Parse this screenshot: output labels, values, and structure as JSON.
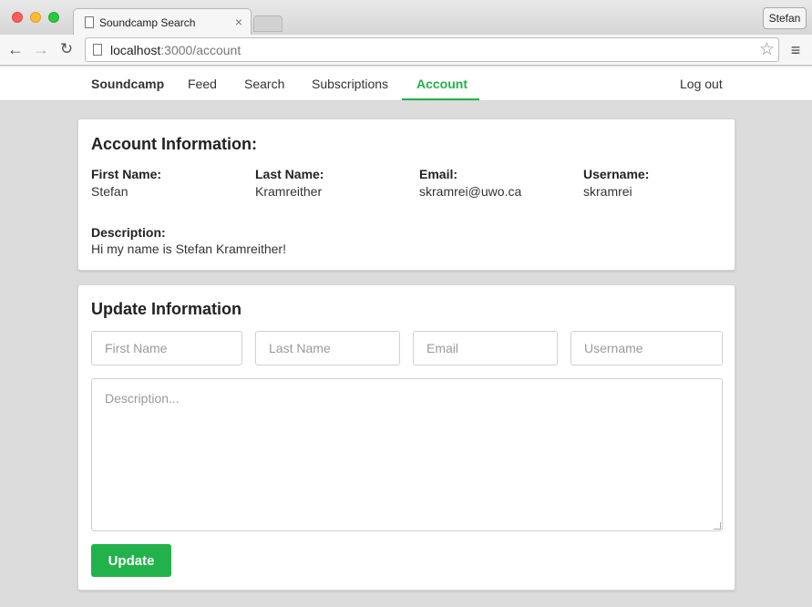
{
  "browser": {
    "tab_title": "Soundcamp Search",
    "tab_close": "×",
    "profile_name": "Stefan",
    "url_host": "localhost",
    "url_path": ":3000/account",
    "back_glyph": "←",
    "forward_glyph": "→",
    "reload_glyph": "↻",
    "star_glyph": "☆",
    "menu_glyph": "≡"
  },
  "nav": {
    "brand": "Soundcamp",
    "items": [
      "Feed",
      "Search",
      "Subscriptions",
      "Account"
    ],
    "active": "Account",
    "logout": "Log out"
  },
  "account_info": {
    "title": "Account Information:",
    "first_name_label": "First Name:",
    "first_name": "Stefan",
    "last_name_label": "Last Name:",
    "last_name": "Kramreither",
    "email_label": "Email:",
    "email": "skramrei@uwo.ca",
    "username_label": "Username:",
    "username": "skramrei",
    "description_label": "Description:",
    "description": "Hi my name is Stefan Kramreither!"
  },
  "update_form": {
    "title": "Update Information",
    "first_name_placeholder": "First Name",
    "last_name_placeholder": "Last Name",
    "email_placeholder": "Email",
    "username_placeholder": "Username",
    "description_placeholder": "Description...",
    "submit_label": "Update"
  },
  "colors": {
    "accent": "#22b24c",
    "page_background": "#dcdcdc"
  }
}
